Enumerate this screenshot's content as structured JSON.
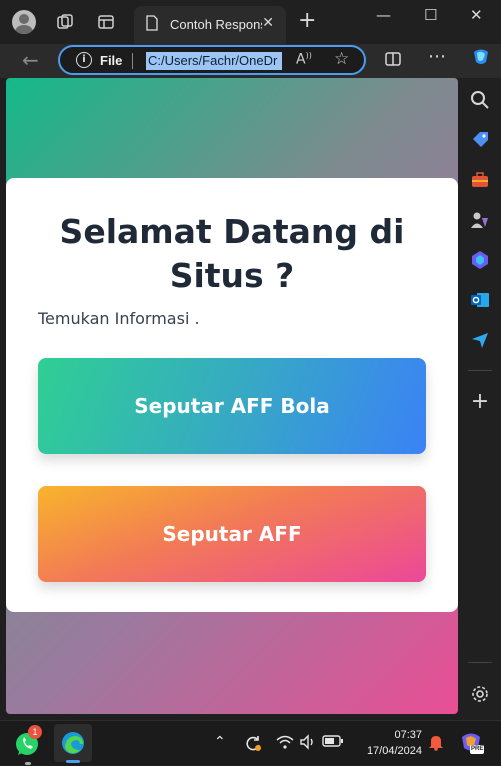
{
  "browser": {
    "tab_title": "Contoh Respons",
    "tab_close": "✕",
    "new_tab": "+",
    "address_file_label": "File",
    "address_url": "C:/Users/Fachr/OneDr",
    "read_aloud": "A⁰",
    "window": {
      "minimize": "—",
      "maximize": "☐",
      "close": "✕"
    }
  },
  "page": {
    "heading": "Selamat Datang di Situs ?",
    "subtitle": "Temukan Informasi .",
    "button_1": "Seputar AFF Bola",
    "button_2": "Seputar AFF"
  },
  "taskbar": {
    "whatsapp_badge": "1",
    "time": "07:37",
    "date": "17/04/2024",
    "copilot_badge": "PRE"
  },
  "colors": {
    "accent": "#4c9cf0",
    "gradient_start": "#14b98a",
    "gradient_end": "#ea4e95",
    "heading": "#1f2937"
  }
}
